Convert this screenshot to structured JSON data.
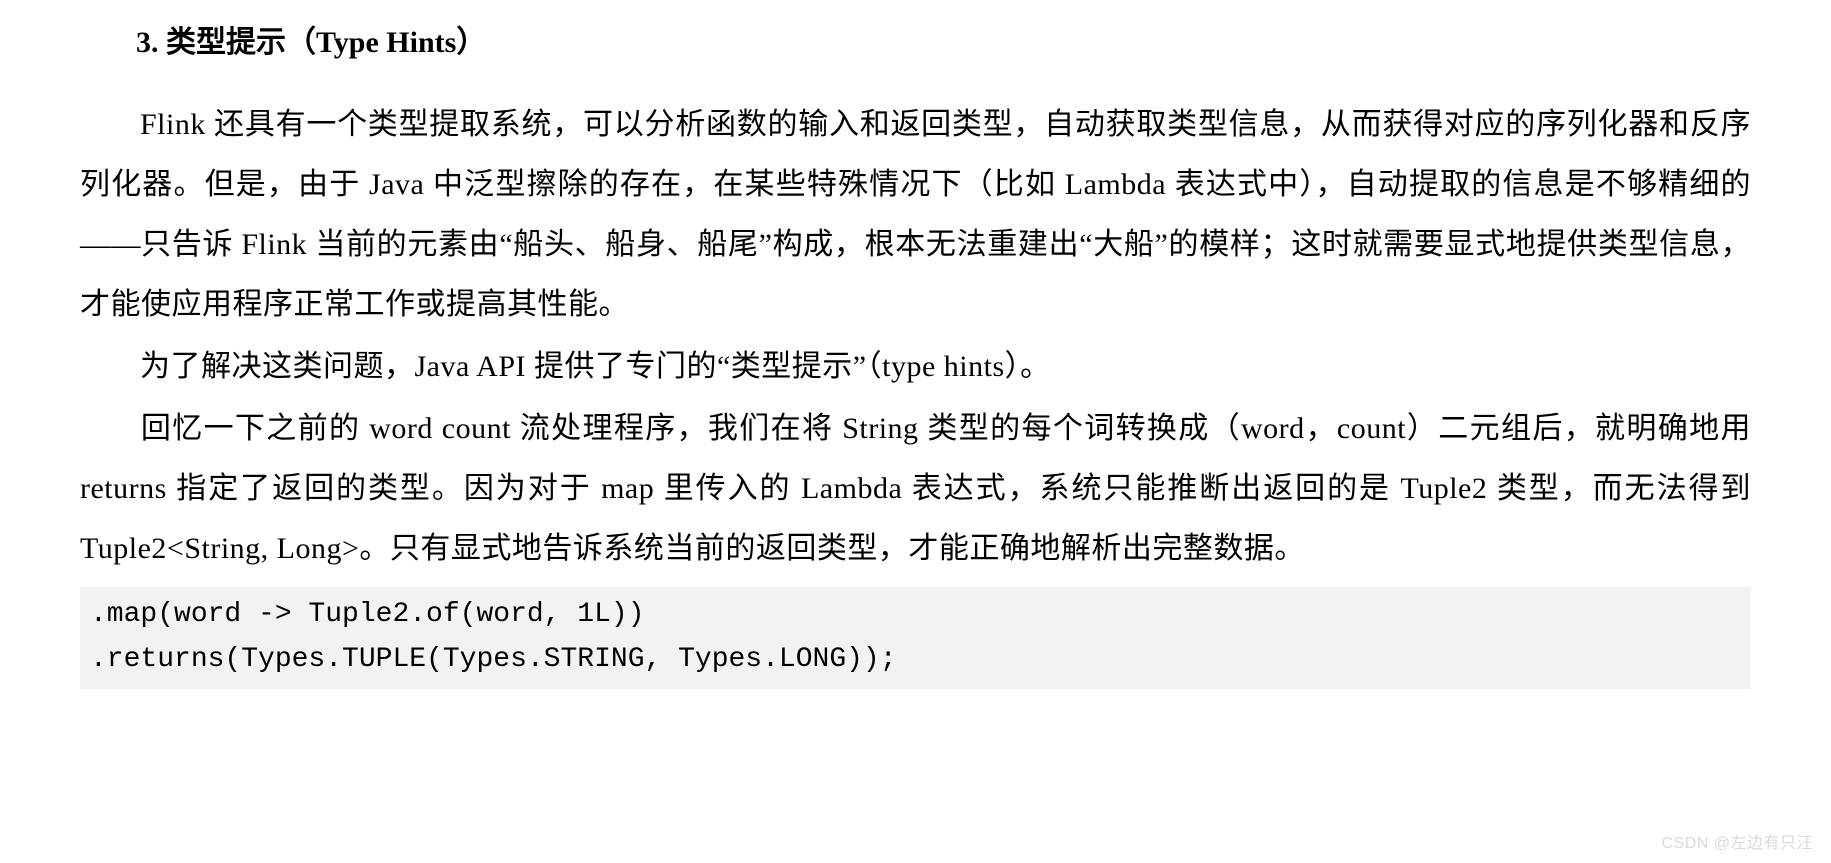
{
  "heading": {
    "number": "3.",
    "title_cn": "类型提示",
    "title_en": "Type Hints"
  },
  "paragraphs": {
    "p1": "Flink 还具有一个类型提取系统，可以分析函数的输入和返回类型，自动获取类型信息，从而获得对应的序列化器和反序列化器。但是，由于 Java 中泛型擦除的存在，在某些特殊情况下（比如 Lambda 表达式中），自动提取的信息是不够精细的——只告诉 Flink 当前的元素由“船头、船身、船尾”构成，根本无法重建出“大船”的模样；这时就需要显式地提供类型信息，才能使应用程序正常工作或提高其性能。",
    "p2": "为了解决这类问题，Java API 提供了专门的“类型提示”（type hints）。",
    "p3": "回忆一下之前的 word count 流处理程序，我们在将 String 类型的每个词转换成（word，count）二元组后，就明确地用 returns 指定了返回的类型。因为对于 map 里传入的 Lambda 表达式，系统只能推断出返回的是 Tuple2 类型，而无法得到 Tuple2<String, Long>。只有显式地告诉系统当前的返回类型，才能正确地解析出完整数据。"
  },
  "code": ".map(word -> Tuple2.of(word, 1L))\n.returns(Types.TUPLE(Types.STRING, Types.LONG));",
  "watermark": "CSDN @左边有只汪"
}
